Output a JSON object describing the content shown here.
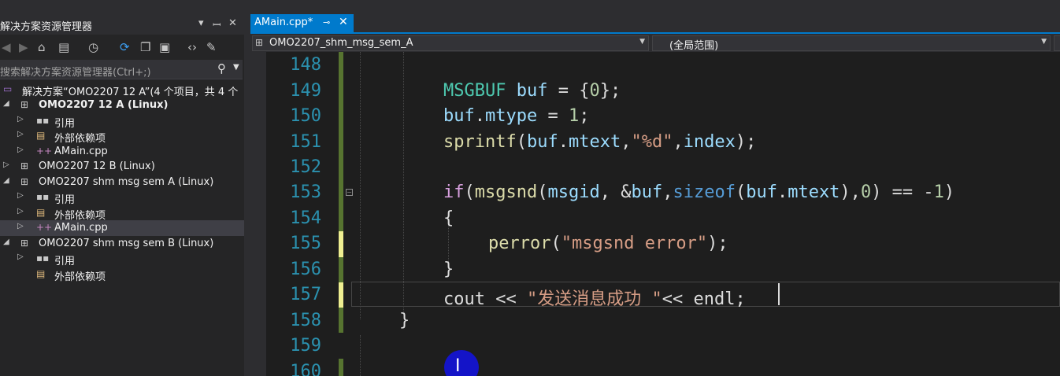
{
  "solution_explorer": {
    "title": "解决方案资源管理器",
    "title_controls": [
      "▾",
      "ꟷ",
      "✕"
    ],
    "search_placeholder": "搜索解决方案资源管理器(Ctrl+;)",
    "tree": [
      {
        "label": "解决方案“OMO2207 12 A”(4 个项目，共 4 个",
        "icon": "solution-icon",
        "arrow": ""
      },
      {
        "label": "OMO2207 12 A (Linux)",
        "icon": "project-icon",
        "arrow": "◢",
        "bold": true
      },
      {
        "label": "引用",
        "icon": "references-icon",
        "arrow": "▷"
      },
      {
        "label": "外部依赖项",
        "icon": "external-deps-icon",
        "arrow": "▷"
      },
      {
        "label": "AMain.cpp",
        "icon": "cpp-file-icon",
        "arrow": "▷"
      },
      {
        "label": "OMO2207 12 B (Linux)",
        "icon": "project-icon",
        "arrow": "▷"
      },
      {
        "label": "OMO2207 shm msg sem A (Linux)",
        "icon": "project-icon",
        "arrow": "◢"
      },
      {
        "label": "引用",
        "icon": "references-icon",
        "arrow": "▷"
      },
      {
        "label": "外部依赖项",
        "icon": "external-deps-icon",
        "arrow": "▷"
      },
      {
        "label": "AMain.cpp",
        "icon": "cpp-file-icon",
        "arrow": "▷",
        "selected": true
      },
      {
        "label": "OMO2207 shm msg sem B (Linux)",
        "icon": "project-icon",
        "arrow": "◢"
      },
      {
        "label": "引用",
        "icon": "references-icon",
        "arrow": "▷"
      },
      {
        "label": "外部依赖项",
        "icon": "external-deps-icon",
        "arrow": ""
      }
    ]
  },
  "editor": {
    "tab_label": "AMain.cpp*",
    "project_dropdown": "OMO2207_shm_msg_sem_A",
    "scope_dropdown": "(全局范围)",
    "line_numbers": [
      "148",
      "149",
      "150",
      "151",
      "152",
      "153",
      "154",
      "155",
      "156",
      "157",
      "158",
      "159",
      "160"
    ],
    "code": {
      "l149": {
        "a": "MSGBUF",
        "b": " buf",
        "c": " = {",
        "d": "0",
        "e": "};"
      },
      "l150": {
        "a": "buf",
        "b": ".",
        "c": "mtype",
        "d": " = ",
        "e": "1",
        "f": ";"
      },
      "l151": {
        "a": "sprintf",
        "b": "(",
        "c": "buf",
        "d": ".",
        "e": "mtext",
        "f": ",",
        "g": "\"%d\"",
        "h": ",",
        "i": "index",
        "j": ");"
      },
      "l153": {
        "a": "if",
        "b": "(",
        "c": "msgsnd",
        "d": "(",
        "e": "msgid",
        "f": ", &",
        "g": "buf",
        "h": ",",
        "i": "sizeof",
        "j": "(",
        "k": "buf",
        "l": ".",
        "m": "mtext",
        "n": "),",
        "o": "0",
        "p": ") == -",
        "q": "1",
        "r": ")"
      },
      "l154": "{",
      "l155": {
        "a": "perror",
        "b": "(",
        "c": "\"msgsnd error\"",
        "d": ");"
      },
      "l156": "}",
      "l157": {
        "a": "cout",
        "b": " << ",
        "c": "\"发送消息成功 \"",
        "d": "<< ",
        "e": "endl",
        "f": ";"
      },
      "l158": "}"
    }
  },
  "colors": {
    "accent": "#007acc",
    "line_number": "#2b91af",
    "type": "#4ec9b0",
    "variable": "#9cdcfe",
    "number": "#b5cea8",
    "function": "#dcdcaa",
    "string": "#d69d85",
    "keyword": "#569cd6",
    "control": "#d8a0df",
    "change_saved": "#577430",
    "change_unsaved": "#efef91"
  }
}
